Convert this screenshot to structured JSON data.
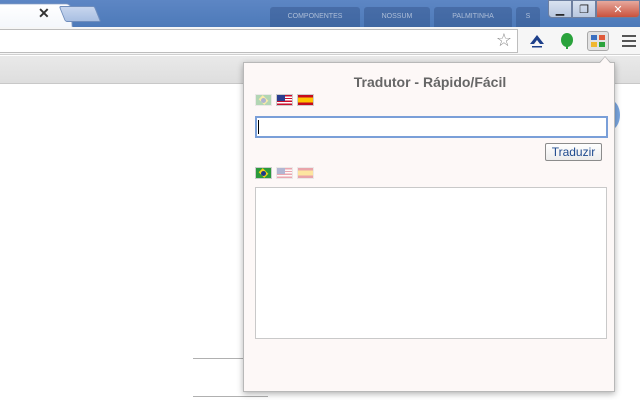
{
  "tabs": {
    "active_close_glyph": "✕",
    "background": [
      "COMPONENTES",
      "NOSSUM",
      "PALMITINHA",
      "S"
    ]
  },
  "window": {
    "minimize_glyph": "▁",
    "restore_glyph": "❐",
    "close_glyph": "✕"
  },
  "toolbar": {
    "bookmark_star_glyph": "☆",
    "extensions": [
      {
        "name": "receita-federal-icon",
        "color": "#1d3f8a"
      },
      {
        "name": "evernote-leaf-icon",
        "color": "#2aa33c"
      },
      {
        "name": "tradutor-extension-icon",
        "color": "#3a6fc0"
      }
    ]
  },
  "popup": {
    "title": "Tradutor - Rápido/Fácil",
    "source_languages": [
      "pt-BR",
      "en-US",
      "es-ES"
    ],
    "source_selected": "en-US",
    "target_languages": [
      "pt-BR",
      "en-US",
      "es-ES"
    ],
    "target_selected": "pt-BR",
    "source_text": "",
    "translate_label": "Traduzir",
    "result_text": "",
    "accent_color": "#7a9fd8"
  }
}
